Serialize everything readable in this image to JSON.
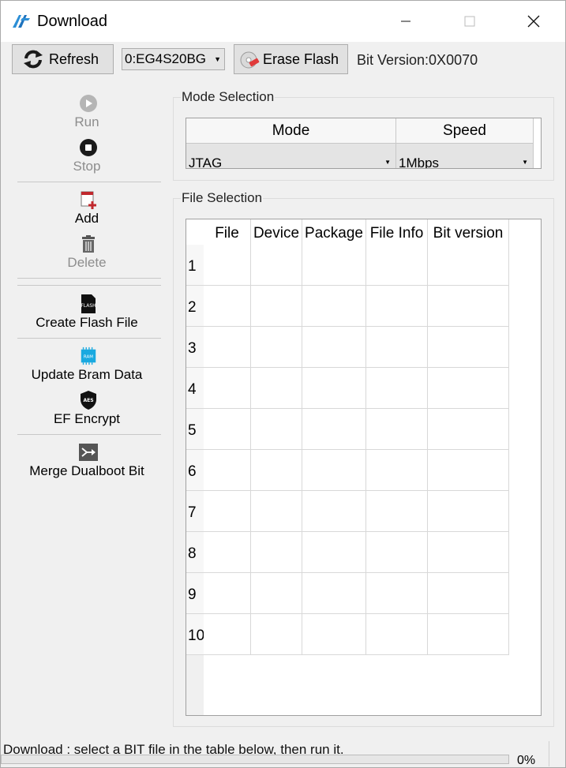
{
  "window": {
    "title": "Download"
  },
  "toolbar": {
    "refresh_label": "Refresh",
    "device_selected": "0:EG4S20BG",
    "erase_label": "Erase Flash",
    "bit_version": "Bit Version:0X0070"
  },
  "sidebar": {
    "run": "Run",
    "stop": "Stop",
    "add": "Add",
    "delete": "Delete",
    "create_flash": "Create Flash File",
    "flash_icon_text": "FLASH",
    "update_bram": "Update Bram Data",
    "bram_icon_text": "RAM",
    "ef_encrypt": "EF Encrypt",
    "aes_icon_text": "AES",
    "merge": "Merge Dualboot Bit"
  },
  "mode_section": {
    "legend": "Mode Selection",
    "headers": {
      "mode": "Mode",
      "speed": "Speed"
    },
    "mode_value": "JTAG",
    "speed_value": "1Mbps"
  },
  "file_section": {
    "legend": "File Selection",
    "columns": [
      "File",
      "Device",
      "Package",
      "File Info",
      "Bit version"
    ],
    "rows": [
      "1",
      "2",
      "3",
      "4",
      "5",
      "6",
      "7",
      "8",
      "9",
      "10"
    ]
  },
  "status": {
    "message": "Download : select a BIT file in the table below, then run it.",
    "progress": 0,
    "percent_label": "0%"
  },
  "colors": {
    "accent": "#1e73be",
    "red": "#c0282d",
    "progress": "#06b025"
  }
}
